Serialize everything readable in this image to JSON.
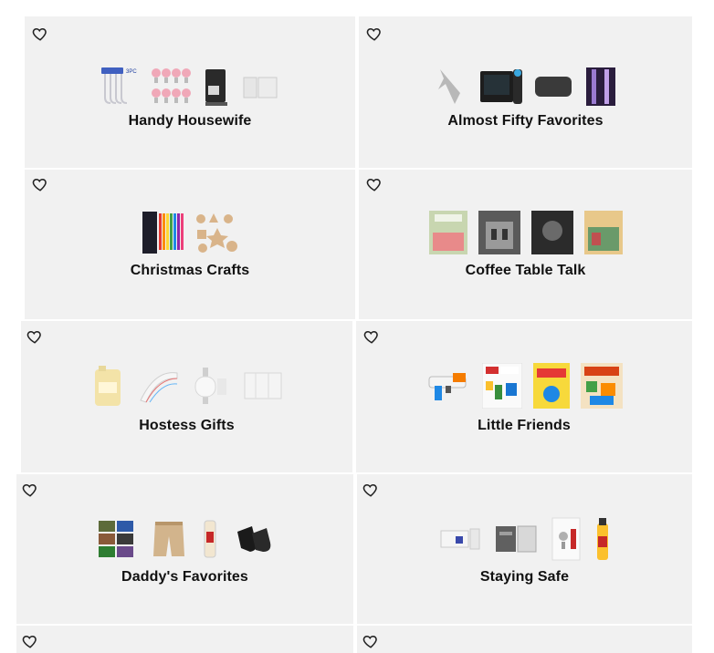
{
  "cards": [
    {
      "title": "Handy Housewife",
      "products": [
        "smart-plug-cables",
        "pink-smart-bulbs",
        "espresso-machine",
        "door-sensors"
      ],
      "icon": "heart-icon"
    },
    {
      "title": "Almost Fifty Favorites",
      "products": [
        "gadget",
        "smart-display",
        "pouch",
        "mascara-set"
      ],
      "icon": "heart-icon"
    },
    {
      "title": "Christmas Crafts",
      "products": [
        "paint-markers",
        "wooden-ornaments"
      ],
      "icon": "heart-icon"
    },
    {
      "title": "Coffee Table Talk",
      "products": [
        "book-coral",
        "book-architecture",
        "book-portrait",
        "book-views"
      ],
      "icon": "heart-icon"
    },
    {
      "title": "Hostess Gifts",
      "products": [
        "detergent-jug",
        "napkins",
        "paper-towel-holder",
        "paper-towels"
      ],
      "icon": "heart-icon"
    },
    {
      "title": "Little Friends",
      "products": [
        "nerf-blaster",
        "lego-ideas-book",
        "dr-seuss-book",
        "richard-scarry-book"
      ],
      "icon": "heart-icon"
    },
    {
      "title": "Daddy's Favorites",
      "products": [
        "camo-hats",
        "cargo-shorts",
        "beef-jerky",
        "black-socks"
      ],
      "icon": "heart-icon"
    },
    {
      "title": "Staying Safe",
      "products": [
        "security-camera",
        "video-doorbell",
        "smart-lock",
        "fire-extinguisher"
      ],
      "icon": "heart-icon"
    },
    {
      "title": "",
      "products": [],
      "icon": "heart-icon"
    },
    {
      "title": "",
      "products": [],
      "icon": "heart-icon"
    }
  ]
}
